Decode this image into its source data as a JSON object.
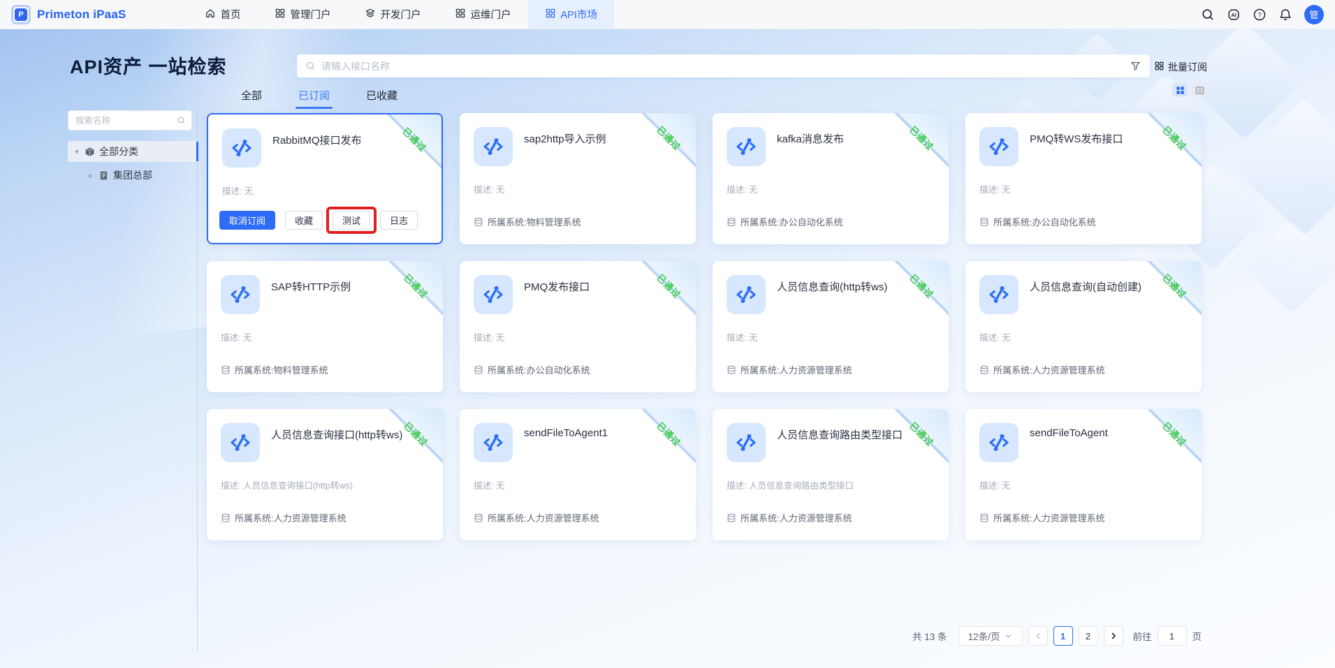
{
  "colors": {
    "primary": "#2e6bf6",
    "ribbon_green": "#3fcb50",
    "annotation_red": "#e01f1f"
  },
  "navbar": {
    "brand": "Primeton iPaaS",
    "items": [
      {
        "label": "首页",
        "icon": "home-icon",
        "active": false
      },
      {
        "label": "管理门户",
        "icon": "grid-icon",
        "active": false
      },
      {
        "label": "开发门户",
        "icon": "layers-icon",
        "active": false
      },
      {
        "label": "运维门户",
        "icon": "grid-icon",
        "active": false
      },
      {
        "label": "API市场",
        "icon": "grid-icon",
        "active": true
      }
    ],
    "right_icons": [
      "search-icon",
      "ai-icon",
      "help-icon",
      "bell-icon"
    ],
    "avatar_text": "管"
  },
  "header": {
    "title": "API资产 一站检索",
    "search_placeholder": "请输入接口名称",
    "batch_subscribe": "批量订阅"
  },
  "tabs": [
    {
      "label": "全部",
      "active": false
    },
    {
      "label": "已订阅",
      "active": true
    },
    {
      "label": "已收藏",
      "active": false
    }
  ],
  "sidebar": {
    "search_placeholder": "搜索名称",
    "tree": [
      {
        "label": "全部分类",
        "expanded": true,
        "selected": true
      },
      {
        "label": "集团总部",
        "expanded": false,
        "selected": false
      }
    ]
  },
  "labels": {
    "desc_prefix": "描述: ",
    "system_prefix": "所属系统:",
    "ribbon": "已通过"
  },
  "cards": [
    {
      "title": "RabbitMQ接口发布",
      "desc": "无",
      "selected": true,
      "actions": [
        {
          "label": "取消订阅",
          "type": "primary"
        },
        {
          "label": "收藏"
        },
        {
          "label": "测试",
          "annotated": true
        },
        {
          "label": "日志"
        }
      ]
    },
    {
      "title": "sap2http导入示例",
      "desc": "无",
      "system": "物料管理系统"
    },
    {
      "title": "kafka消息发布",
      "desc": "无",
      "system": "办公自动化系统"
    },
    {
      "title": "PMQ转WS发布接口",
      "desc": "无",
      "system": "办公自动化系统"
    },
    {
      "title": "SAP转HTTP示例",
      "desc": "无",
      "system": "物料管理系统"
    },
    {
      "title": "PMQ发布接口",
      "desc": "无",
      "system": "办公自动化系统"
    },
    {
      "title": "人员信息查询(http转ws)",
      "desc": "无",
      "system": "人力资源管理系统"
    },
    {
      "title": "人员信息查询(自动创建)",
      "desc": "无",
      "system": "人力资源管理系统"
    },
    {
      "title": "人员信息查询接口(http转ws)",
      "desc": "人员信息查询接口(http转ws)",
      "system": "人力资源管理系统"
    },
    {
      "title": "sendFileToAgent1",
      "desc": "无",
      "system": "人力资源管理系统"
    },
    {
      "title": "人员信息查询路由类型接口",
      "desc": "人员信息查询路由类型接口",
      "system": "人力资源管理系统"
    },
    {
      "title": "sendFileToAgent",
      "desc": "无",
      "system": "人力资源管理系统"
    }
  ],
  "pagination": {
    "total": "共 13 条",
    "page_size": "12条/页",
    "pages": [
      "1",
      "2"
    ],
    "current": "1",
    "goto_label": "前往",
    "goto_value": "1",
    "unit": "页"
  }
}
